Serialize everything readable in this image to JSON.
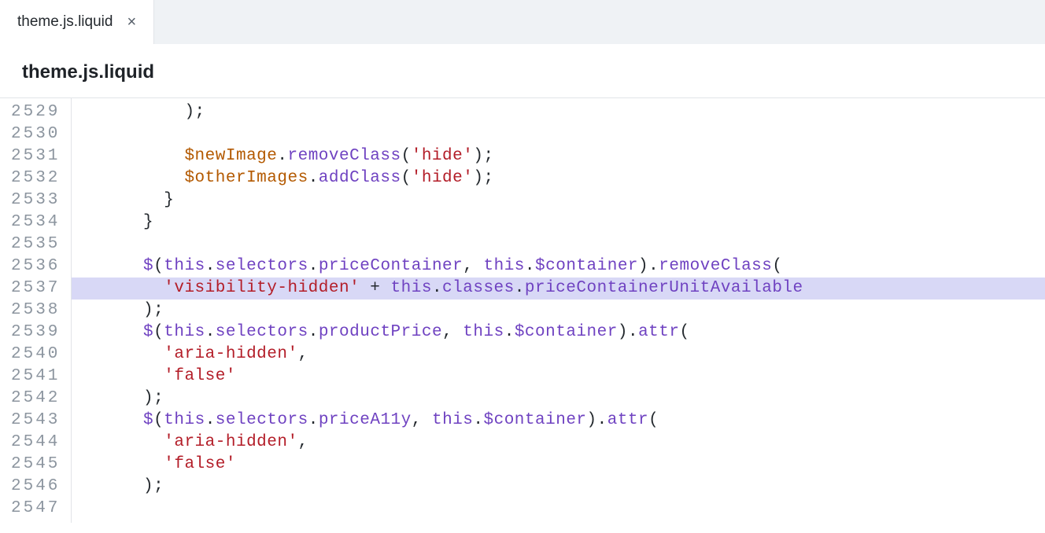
{
  "tab": {
    "label": "theme.js.liquid",
    "close_glyph": "×"
  },
  "file_title": "theme.js.liquid",
  "gutter": {
    "start": 2529,
    "lines": [
      "2529",
      "2530",
      "2531",
      "2532",
      "2533",
      "2534",
      "2535",
      "2536",
      "2537",
      "2538",
      "2539",
      "2540",
      "2541",
      "2542",
      "2543",
      "2544",
      "2545",
      "2546",
      "2547"
    ]
  },
  "highlighted_line_index": 8,
  "code_tokens": {
    "l0": [
      [
        "punc",
        "          );"
      ]
    ],
    "l1": [
      [
        "punc",
        ""
      ]
    ],
    "l2": [
      [
        "punc",
        "          "
      ],
      [
        "var",
        "$newImage"
      ],
      [
        "punc",
        "."
      ],
      [
        "method",
        "removeClass"
      ],
      [
        "punc",
        "("
      ],
      [
        "str",
        "'hide'"
      ],
      [
        "punc",
        ");"
      ]
    ],
    "l3": [
      [
        "punc",
        "          "
      ],
      [
        "var",
        "$otherImages"
      ],
      [
        "punc",
        "."
      ],
      [
        "method",
        "addClass"
      ],
      [
        "punc",
        "("
      ],
      [
        "str",
        "'hide'"
      ],
      [
        "punc",
        ");"
      ]
    ],
    "l4": [
      [
        "punc",
        "        }"
      ]
    ],
    "l5": [
      [
        "punc",
        "      }"
      ]
    ],
    "l6": [
      [
        "punc",
        ""
      ]
    ],
    "l7": [
      [
        "punc",
        "      "
      ],
      [
        "dollar",
        "$"
      ],
      [
        "punc",
        "("
      ],
      [
        "kw",
        "this"
      ],
      [
        "punc",
        "."
      ],
      [
        "method",
        "selectors"
      ],
      [
        "punc",
        "."
      ],
      [
        "method",
        "priceContainer"
      ],
      [
        "punc",
        ", "
      ],
      [
        "kw",
        "this"
      ],
      [
        "punc",
        "."
      ],
      [
        "method",
        "$container"
      ],
      [
        "punc",
        ")."
      ],
      [
        "method",
        "removeClass"
      ],
      [
        "punc",
        "("
      ]
    ],
    "l8": [
      [
        "punc",
        "        "
      ],
      [
        "str",
        "'visibility-hidden'"
      ],
      [
        "punc",
        " + "
      ],
      [
        "kw",
        "this"
      ],
      [
        "punc",
        "."
      ],
      [
        "method",
        "classes"
      ],
      [
        "punc",
        "."
      ],
      [
        "method",
        "priceContainerUnitAvailable"
      ]
    ],
    "l9": [
      [
        "punc",
        "      );"
      ]
    ],
    "l10": [
      [
        "punc",
        "      "
      ],
      [
        "dollar",
        "$"
      ],
      [
        "punc",
        "("
      ],
      [
        "kw",
        "this"
      ],
      [
        "punc",
        "."
      ],
      [
        "method",
        "selectors"
      ],
      [
        "punc",
        "."
      ],
      [
        "method",
        "productPrice"
      ],
      [
        "punc",
        ", "
      ],
      [
        "kw",
        "this"
      ],
      [
        "punc",
        "."
      ],
      [
        "method",
        "$container"
      ],
      [
        "punc",
        ")."
      ],
      [
        "method",
        "attr"
      ],
      [
        "punc",
        "("
      ]
    ],
    "l11": [
      [
        "punc",
        "        "
      ],
      [
        "str",
        "'aria-hidden'"
      ],
      [
        "punc",
        ","
      ]
    ],
    "l12": [
      [
        "punc",
        "        "
      ],
      [
        "str",
        "'false'"
      ]
    ],
    "l13": [
      [
        "punc",
        "      );"
      ]
    ],
    "l14": [
      [
        "punc",
        "      "
      ],
      [
        "dollar",
        "$"
      ],
      [
        "punc",
        "("
      ],
      [
        "kw",
        "this"
      ],
      [
        "punc",
        "."
      ],
      [
        "method",
        "selectors"
      ],
      [
        "punc",
        "."
      ],
      [
        "method",
        "priceA11y"
      ],
      [
        "punc",
        ", "
      ],
      [
        "kw",
        "this"
      ],
      [
        "punc",
        "."
      ],
      [
        "method",
        "$container"
      ],
      [
        "punc",
        ")."
      ],
      [
        "method",
        "attr"
      ],
      [
        "punc",
        "("
      ]
    ],
    "l15": [
      [
        "punc",
        "        "
      ],
      [
        "str",
        "'aria-hidden'"
      ],
      [
        "punc",
        ","
      ]
    ],
    "l16": [
      [
        "punc",
        "        "
      ],
      [
        "str",
        "'false'"
      ]
    ],
    "l17": [
      [
        "punc",
        "      );"
      ]
    ],
    "l18": [
      [
        "punc",
        ""
      ]
    ]
  },
  "token_class_map": {
    "punc": "tok-punc",
    "var": "tok-var",
    "method": "tok-method",
    "str": "tok-str",
    "kw": "tok-kw",
    "plain": "tok-plain",
    "dollar": "tok-dollar"
  }
}
